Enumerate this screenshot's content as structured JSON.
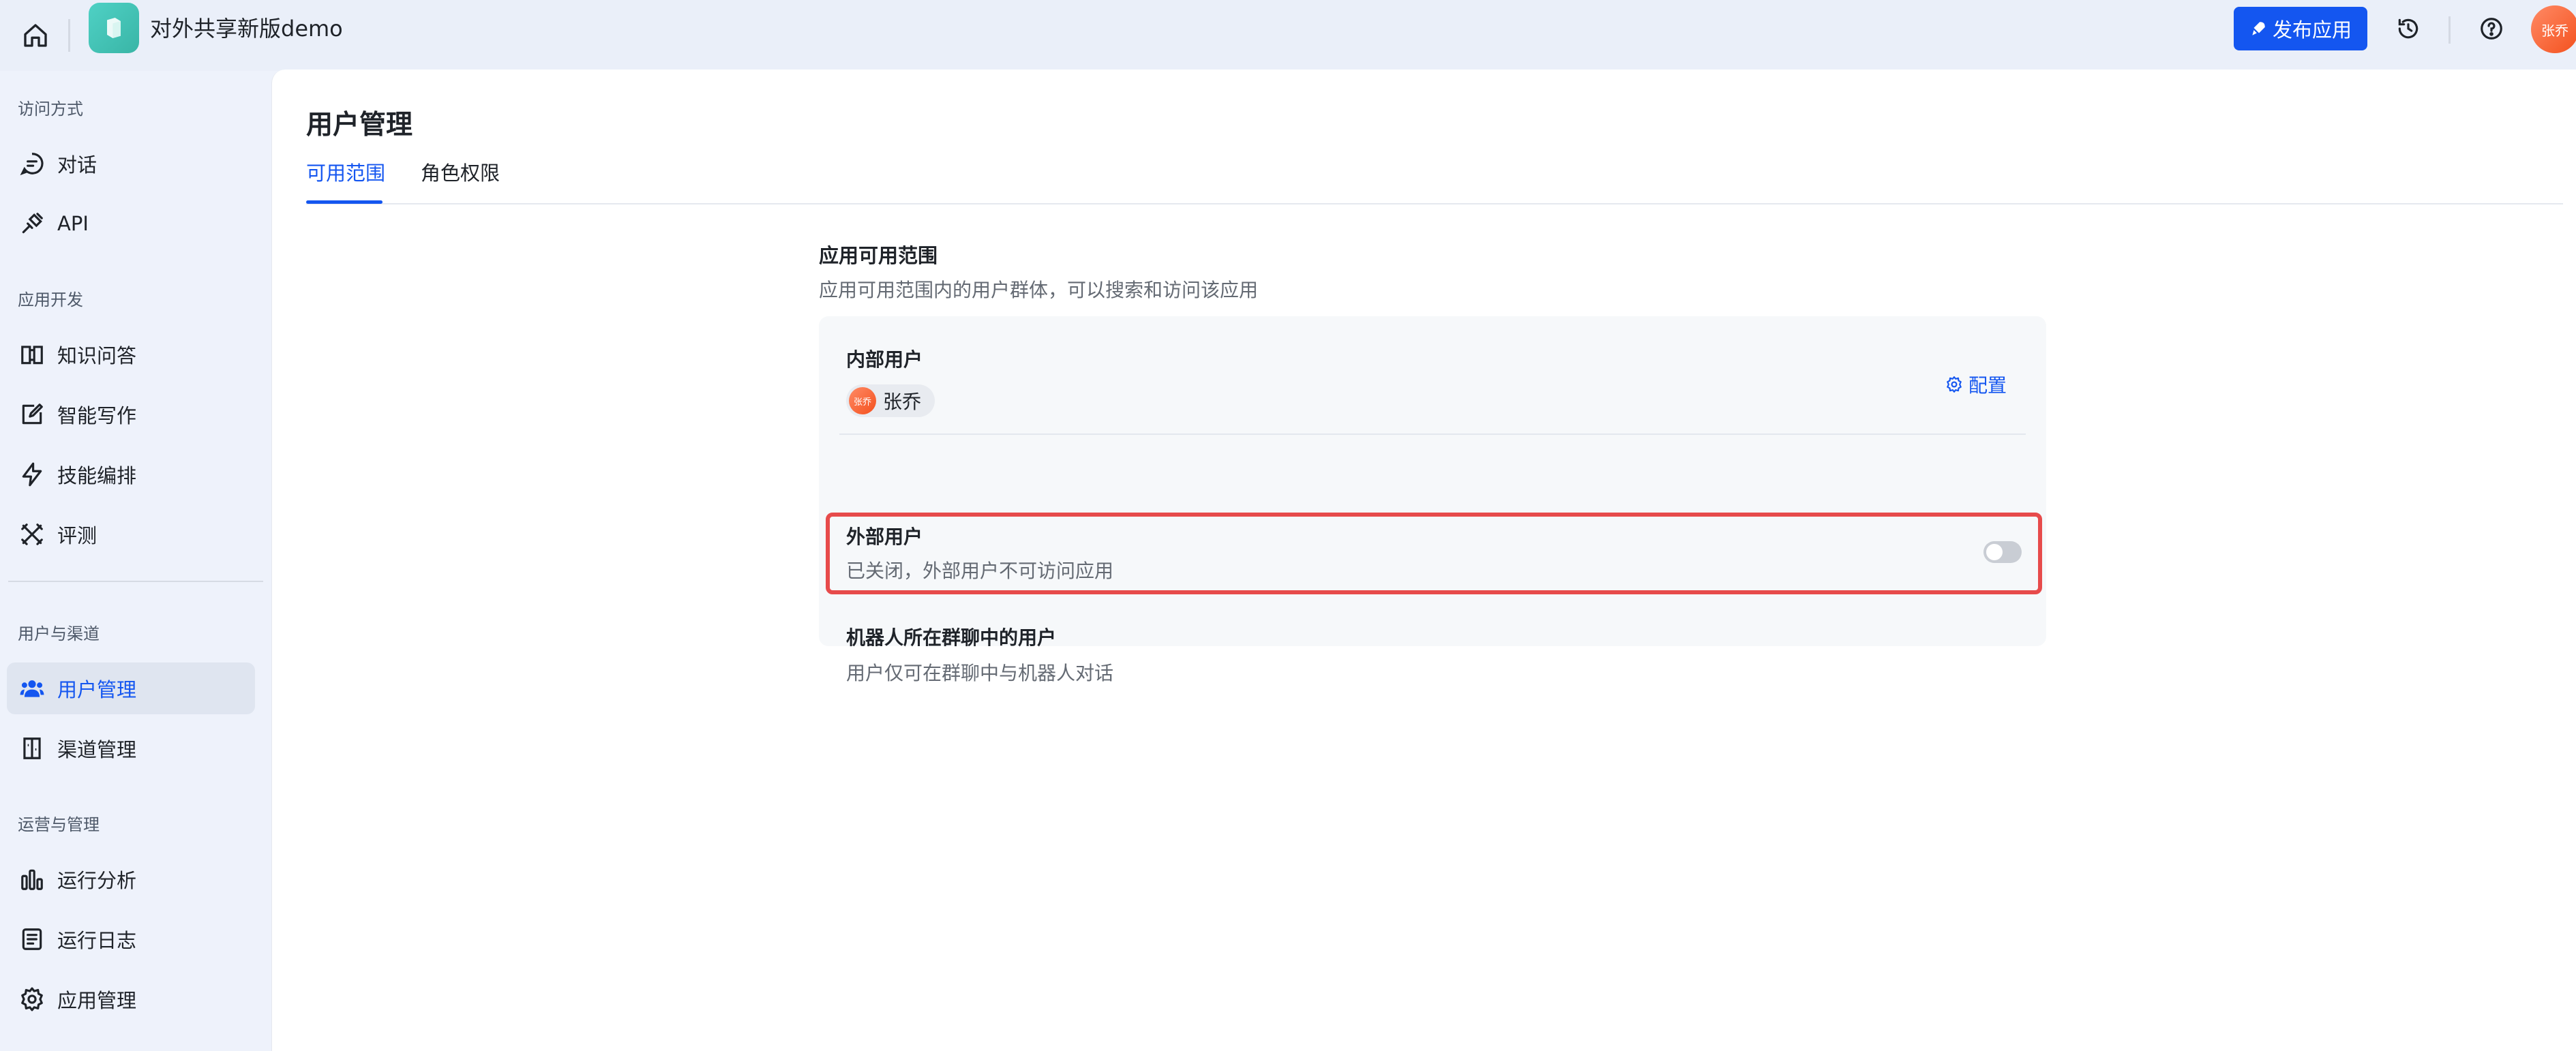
{
  "header": {
    "app_title": "对外共享新版demo",
    "publish_label": "发布应用",
    "user_avatar_text": "张乔",
    "icons": [
      "home-icon",
      "history-icon",
      "help-icon"
    ]
  },
  "sidebar": {
    "sections": [
      {
        "title": "访问方式",
        "items": [
          {
            "label": "对话",
            "icon": "chat-icon"
          },
          {
            "label": "API",
            "icon": "api-icon"
          }
        ]
      },
      {
        "title": "应用开发",
        "items": [
          {
            "label": "知识问答",
            "icon": "book-icon"
          },
          {
            "label": "智能写作",
            "icon": "write-icon"
          },
          {
            "label": "技能编排",
            "icon": "lightning-icon"
          },
          {
            "label": "评测",
            "icon": "tools-icon"
          }
        ]
      },
      {
        "title": "用户与渠道",
        "items": [
          {
            "label": "用户管理",
            "icon": "users-icon",
            "active": true
          },
          {
            "label": "渠道管理",
            "icon": "channel-icon"
          }
        ]
      },
      {
        "title": "运营与管理",
        "items": [
          {
            "label": "运行分析",
            "icon": "chart-icon"
          },
          {
            "label": "运行日志",
            "icon": "log-icon"
          },
          {
            "label": "应用管理",
            "icon": "gear-icon"
          }
        ]
      }
    ]
  },
  "main": {
    "page_title": "用户管理",
    "tabs": [
      {
        "label": "可用范围",
        "active": true
      },
      {
        "label": "角色权限",
        "active": false
      }
    ],
    "scope": {
      "title": "应用可用范围",
      "description": "应用可用范围内的用户群体，可以搜索和访问该应用",
      "internal": {
        "title": "内部用户",
        "user_chip": "张乔",
        "chip_avatar": "张乔",
        "config_label": "配置"
      },
      "external": {
        "title": "外部用户",
        "description": "已关闭，外部用户不可访问应用",
        "enabled": false
      },
      "robot": {
        "title": "机器人所在群聊中的用户",
        "description": "用户仅可在群聊中与机器人对话"
      }
    }
  },
  "colors": {
    "accent": "#1456f0",
    "highlight": "#e74b4b"
  }
}
